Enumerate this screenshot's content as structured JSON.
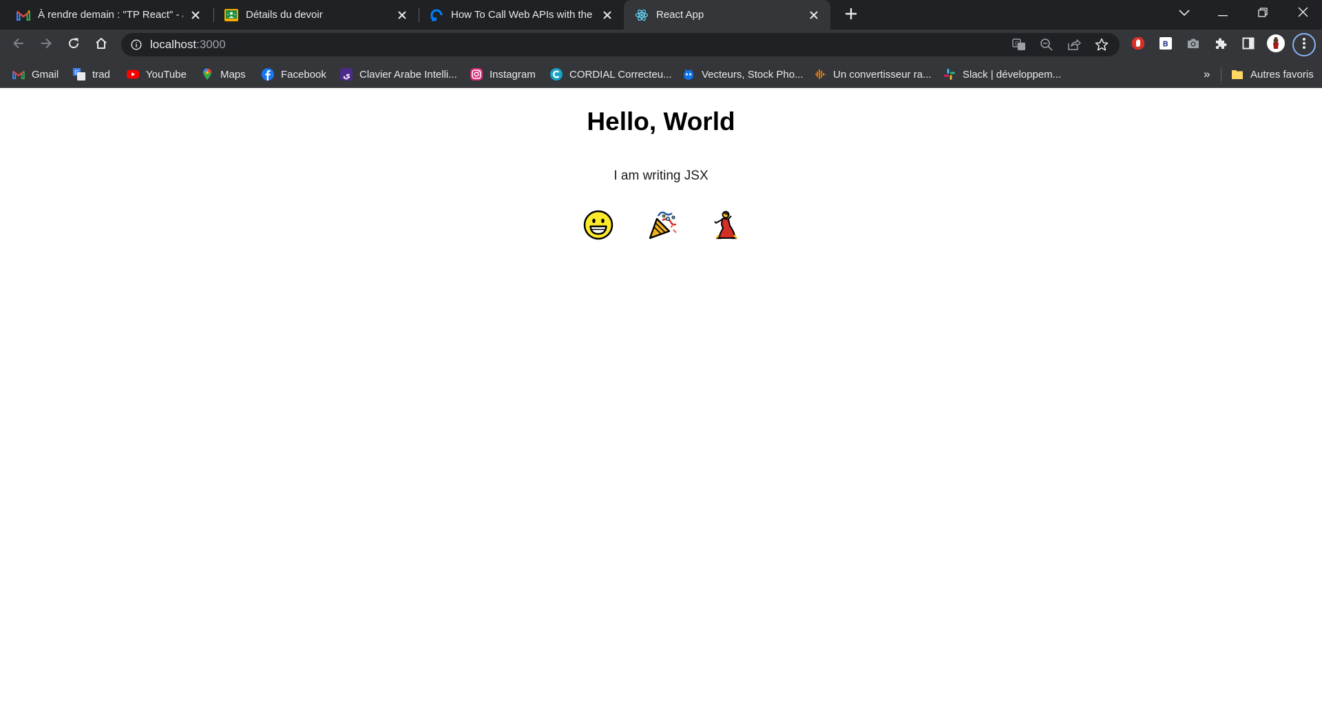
{
  "browser": {
    "tabs": [
      {
        "title": "À rendre demain : \"TP React\" - an",
        "icon": "gmail-icon",
        "active": false
      },
      {
        "title": "Détails du devoir",
        "icon": "classroom-icon",
        "active": false
      },
      {
        "title": "How To Call Web APIs with the us",
        "icon": "digitalocean-icon",
        "active": false
      },
      {
        "title": "React App",
        "icon": "react-icon",
        "active": true
      }
    ],
    "new_tab_icon": "plus-icon",
    "address": {
      "host": "localhost",
      "port": ":3000"
    },
    "bookmarks": [
      {
        "label": "Gmail",
        "icon": "gmail-icon"
      },
      {
        "label": "trad",
        "icon": "translate-icon"
      },
      {
        "label": "YouTube",
        "icon": "youtube-icon"
      },
      {
        "label": "Maps",
        "icon": "maps-icon"
      },
      {
        "label": "Facebook",
        "icon": "facebook-icon"
      },
      {
        "label": "Clavier Arabe Intelli...",
        "icon": "keyboard-icon"
      },
      {
        "label": "Instagram",
        "icon": "instagram-icon"
      },
      {
        "label": "CORDIAL Correcteu...",
        "icon": "cordial-icon"
      },
      {
        "label": "Vecteurs, Stock Pho...",
        "icon": "freepik-icon"
      },
      {
        "label": "Un convertisseur ra...",
        "icon": "audio-icon"
      },
      {
        "label": "Slack | développem...",
        "icon": "slack-icon"
      }
    ],
    "more_bookmarks": "»",
    "other_bookmarks": "Autres favoris"
  },
  "page": {
    "heading": "Hello, World",
    "paragraph": "I am writing JSX",
    "emojis": [
      "grinning-face",
      "party-popper",
      "woman-dancing"
    ]
  },
  "colors": {
    "chrome_dark": "#202124",
    "chrome_toolbar": "#35363a",
    "text_light": "#e8eaed"
  }
}
